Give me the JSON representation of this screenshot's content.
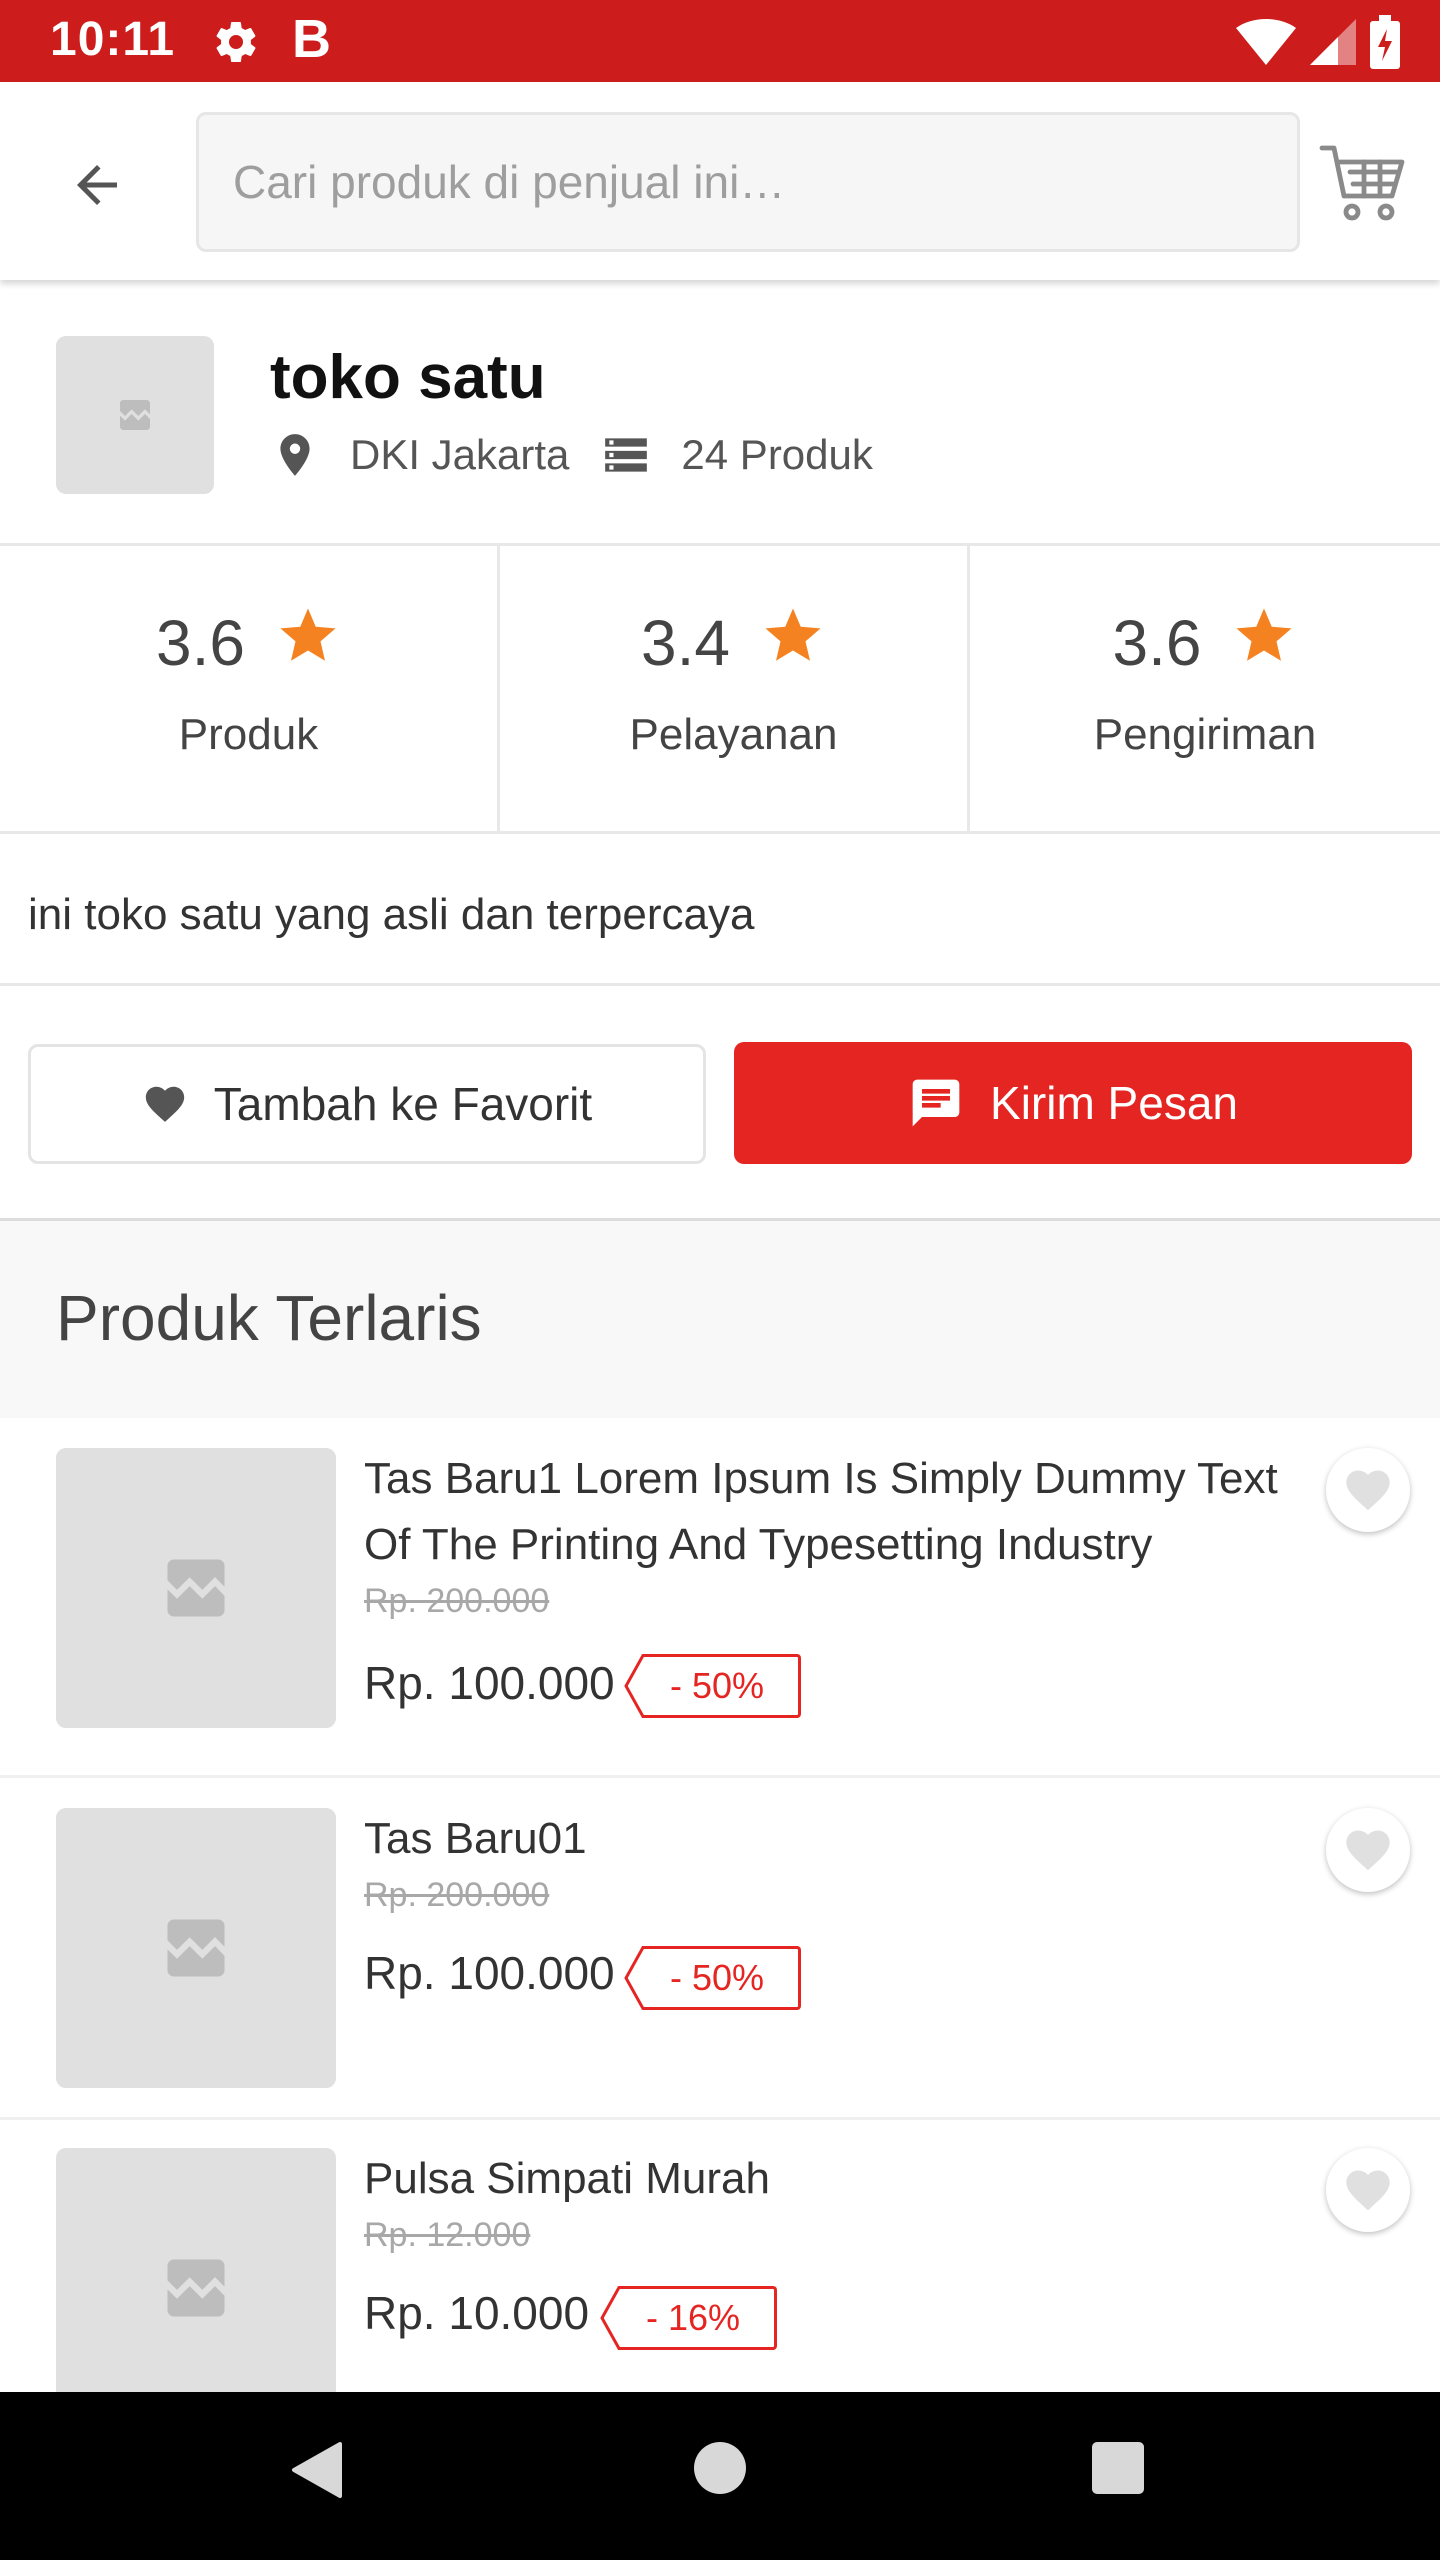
{
  "status_bar": {
    "time": "10:11",
    "notification_letter": "B",
    "icons": [
      "gear-icon",
      "wifi-icon",
      "signal-icon",
      "battery-charging-icon"
    ]
  },
  "app_bar": {
    "search_placeholder": "Cari produk di penjual ini…",
    "icons": [
      "arrow-back-icon",
      "cart-icon"
    ]
  },
  "shop": {
    "name": "toko satu",
    "location": "DKI Jakarta",
    "product_count": "24 Produk",
    "description": "ini toko satu yang asli dan terpercaya"
  },
  "ratings": [
    {
      "value": "3.6",
      "label": "Produk"
    },
    {
      "value": "3.4",
      "label": "Pelayanan"
    },
    {
      "value": "3.6",
      "label": "Pengiriman"
    }
  ],
  "actions": {
    "favorite_label": "Tambah ke Favorit",
    "message_label": "Kirim Pesan"
  },
  "section": {
    "title": "Produk Terlaris"
  },
  "products": [
    {
      "name": "Tas Baru1 Lorem Ipsum Is Simply Dummy Text Of The Printing And Typesetting Industry",
      "old_price": "Rp. 200.000",
      "price": "Rp. 100.000",
      "discount": "- 50%"
    },
    {
      "name": "Tas Baru01",
      "old_price": "Rp. 200.000",
      "price": "Rp. 100.000",
      "discount": "- 50%"
    },
    {
      "name": "Pulsa Simpati Murah",
      "old_price": "Rp. 12.000",
      "price": "Rp. 10.000",
      "discount": "- 16%"
    }
  ],
  "colors": {
    "status_bar": "#cd1c1c",
    "accent_red": "#e52521",
    "star_orange": "#f58220",
    "placeholder_gray": "#e0e0e0"
  }
}
